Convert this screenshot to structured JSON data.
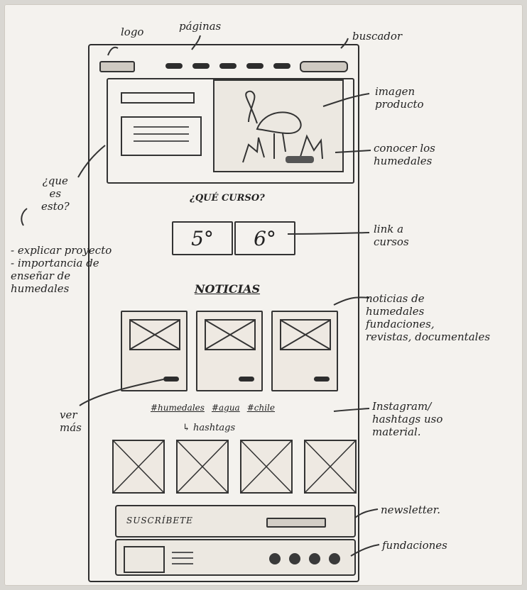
{
  "notes": {
    "logo": "logo",
    "paginas": "páginas",
    "buscador": "buscador",
    "imagen_producto": "imagen\nproducto",
    "conocer": "conocer los\nhumedales",
    "que_es": "¿que\nes\nesto?",
    "explicar": "- explicar proyecto\n- importancia de\nenseñar de\nhumedales",
    "link_cursos": "link a\ncursos",
    "noticias_note": "noticias de\nhumedales\nfundaciones,\nrevistas, documentales",
    "ver_mas": "ver\nmás",
    "instagram": "Instagram/\nhashtags uso\nmaterial.",
    "newsletter": "newsletter.",
    "fundaciones": "fundaciones"
  },
  "page": {
    "course_title": "¿QUÉ CURSO?",
    "courses": [
      "5°",
      "6°"
    ],
    "news_title": "NOTICIAS",
    "hashtags": [
      "#humedales",
      "#agua",
      "#chile"
    ],
    "hashtag_caption": "↳ hashtags",
    "newsletter_label": "SUSCRÍBETE"
  }
}
